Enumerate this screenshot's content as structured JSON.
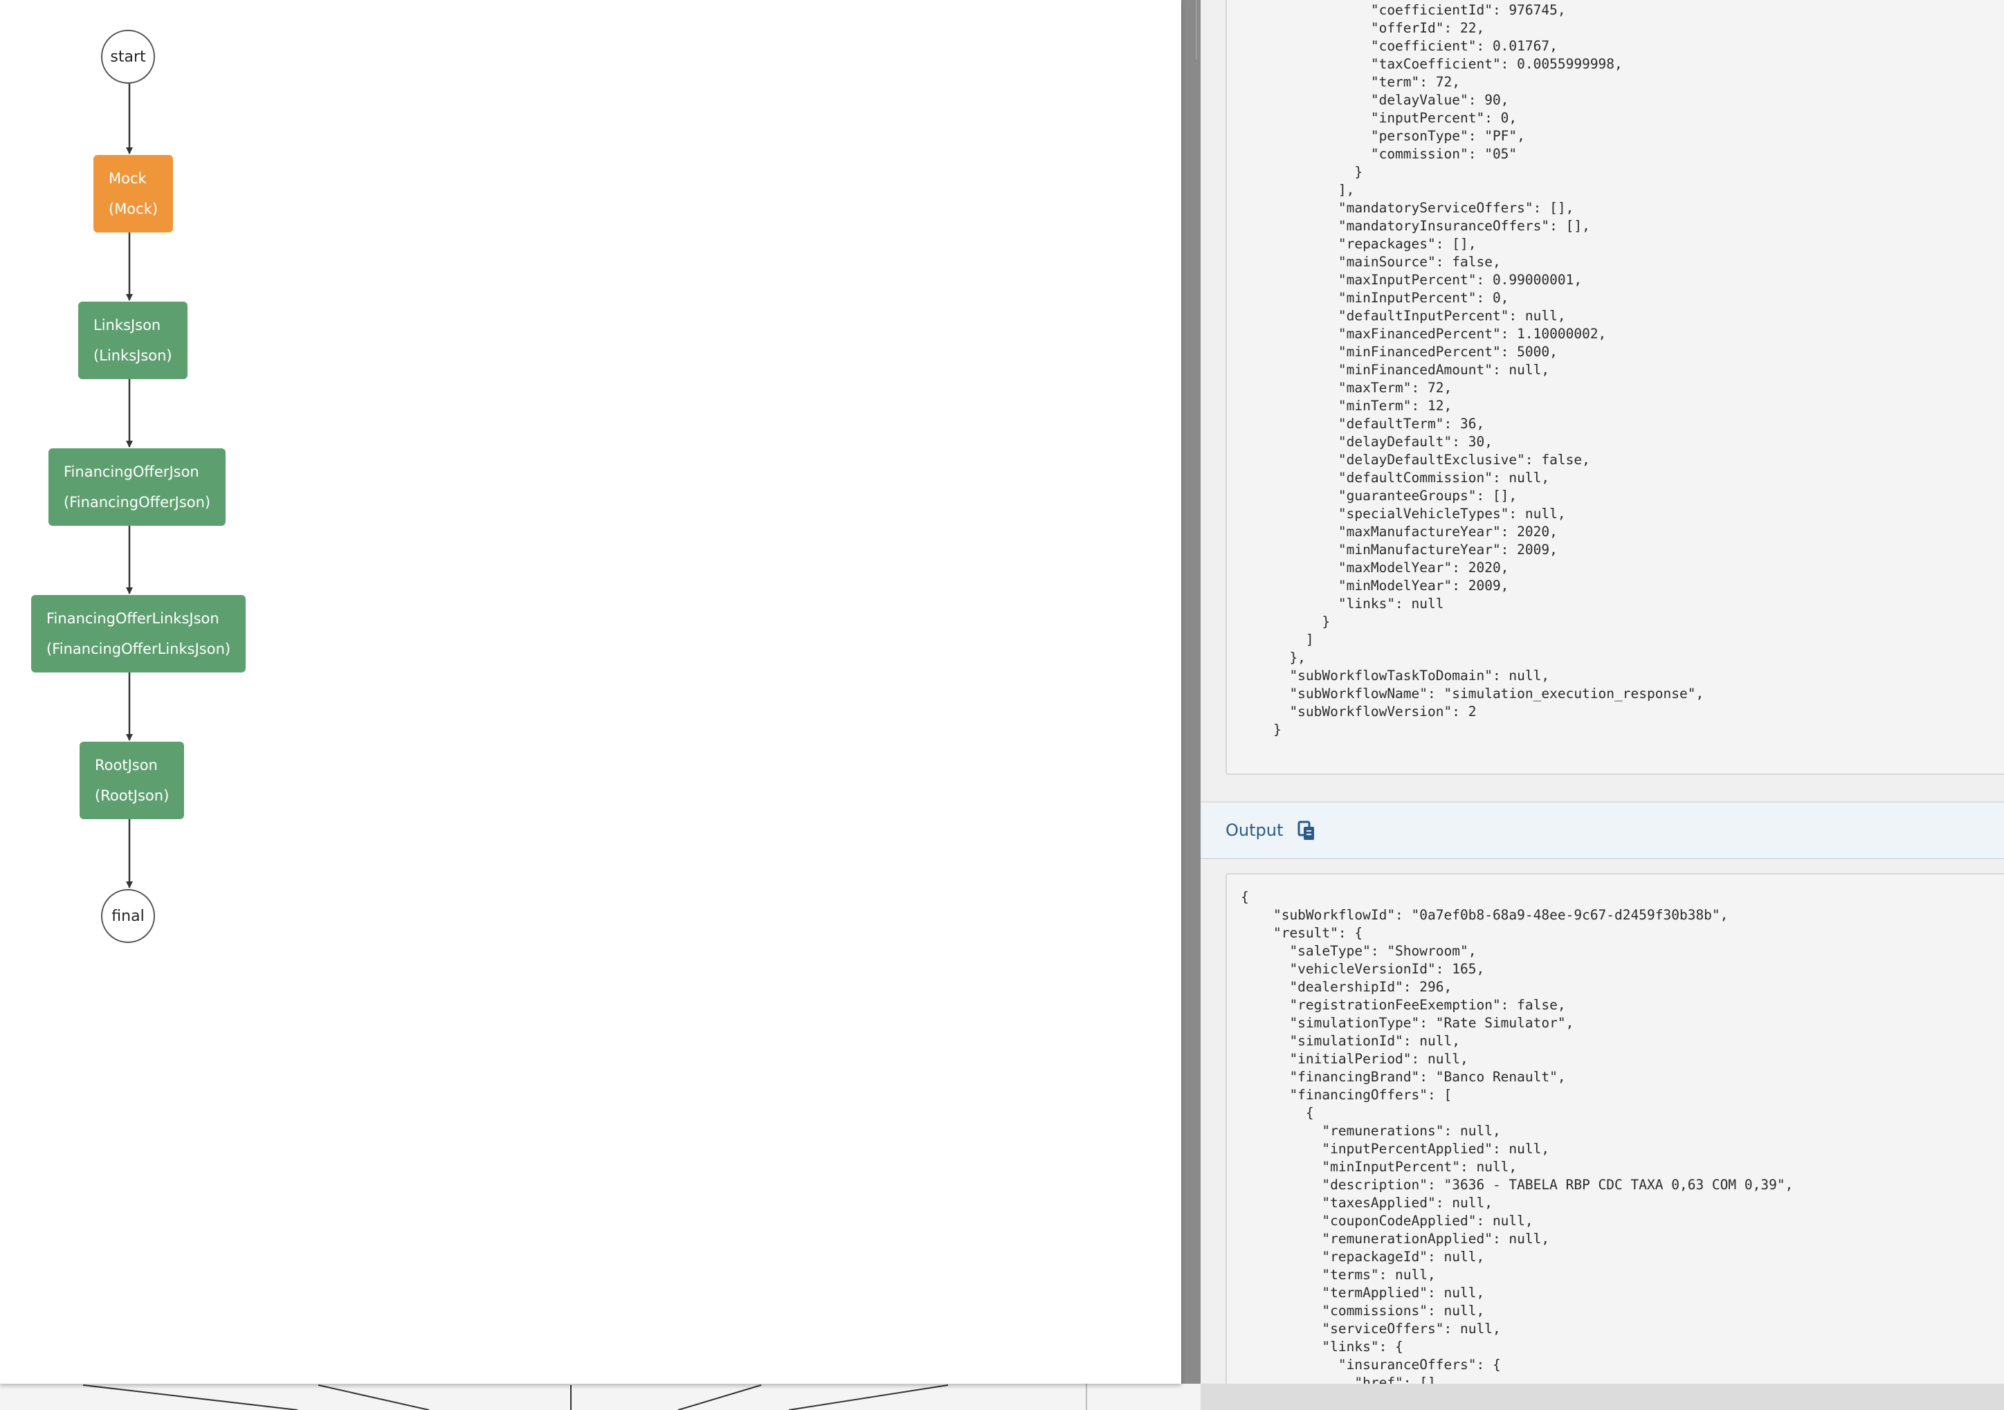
{
  "graph": {
    "start_label": "start",
    "final_label": "final",
    "tasks": [
      {
        "name": "Mock",
        "ref": "(Mock)",
        "status_color": "#f0963a"
      },
      {
        "name": "LinksJson",
        "ref": "(LinksJson)",
        "status_color": "#5e9f70"
      },
      {
        "name": "FinancingOfferJson",
        "ref": "(FinancingOfferJson)",
        "status_color": "#5e9f70"
      },
      {
        "name": "FinancingOfferLinksJson",
        "ref": "(FinancingOfferLinksJson)",
        "status_color": "#5e9f70"
      },
      {
        "name": "RootJson",
        "ref": "(RootJson)",
        "status_color": "#5e9f70"
      }
    ]
  },
  "details": {
    "input_json": "                \"coefficientId\": 976745,\n                \"offerId\": 22,\n                \"coefficient\": 0.01767,\n                \"taxCoefficient\": 0.0055999998,\n                \"term\": 72,\n                \"delayValue\": 90,\n                \"inputPercent\": 0,\n                \"personType\": \"PF\",\n                \"commission\": \"05\"\n              }\n            ],\n            \"mandatoryServiceOffers\": [],\n            \"mandatoryInsuranceOffers\": [],\n            \"repackages\": [],\n            \"mainSource\": false,\n            \"maxInputPercent\": 0.99000001,\n            \"minInputPercent\": 0,\n            \"defaultInputPercent\": null,\n            \"maxFinancedPercent\": 1.10000002,\n            \"minFinancedPercent\": 5000,\n            \"minFinancedAmount\": null,\n            \"maxTerm\": 72,\n            \"minTerm\": 12,\n            \"defaultTerm\": 36,\n            \"delayDefault\": 30,\n            \"delayDefaultExclusive\": false,\n            \"defaultCommission\": null,\n            \"guaranteeGroups\": [],\n            \"specialVehicleTypes\": null,\n            \"maxManufactureYear\": 2020,\n            \"minManufactureYear\": 2009,\n            \"maxModelYear\": 2020,\n            \"minModelYear\": 2009,\n            \"links\": null\n          }\n        ]\n      },\n      \"subWorkflowTaskToDomain\": null,\n      \"subWorkflowName\": \"simulation_execution_response\",\n      \"subWorkflowVersion\": 2\n    }",
    "output_label": "Output",
    "output_json": "{\n    \"subWorkflowId\": \"0a7ef0b8-68a9-48ee-9c67-d2459f30b38b\",\n    \"result\": {\n      \"saleType\": \"Showroom\",\n      \"vehicleVersionId\": 165,\n      \"dealershipId\": 296,\n      \"registrationFeeExemption\": false,\n      \"simulationType\": \"Rate Simulator\",\n      \"simulationId\": null,\n      \"initialPeriod\": null,\n      \"financingBrand\": \"Banco Renault\",\n      \"financingOffers\": [\n        {\n          \"remunerations\": null,\n          \"inputPercentApplied\": null,\n          \"minInputPercent\": null,\n          \"description\": \"3636 - TABELA RBP CDC TAXA 0,63 COM 0,39\",\n          \"taxesApplied\": null,\n          \"couponCodeApplied\": null,\n          \"remunerationApplied\": null,\n          \"repackageId\": null,\n          \"terms\": null,\n          \"termApplied\": null,\n          \"commissions\": null,\n          \"serviceOffers\": null,\n          \"links\": {\n            \"insuranceOffers\": {\n              \"href\": []"
  }
}
